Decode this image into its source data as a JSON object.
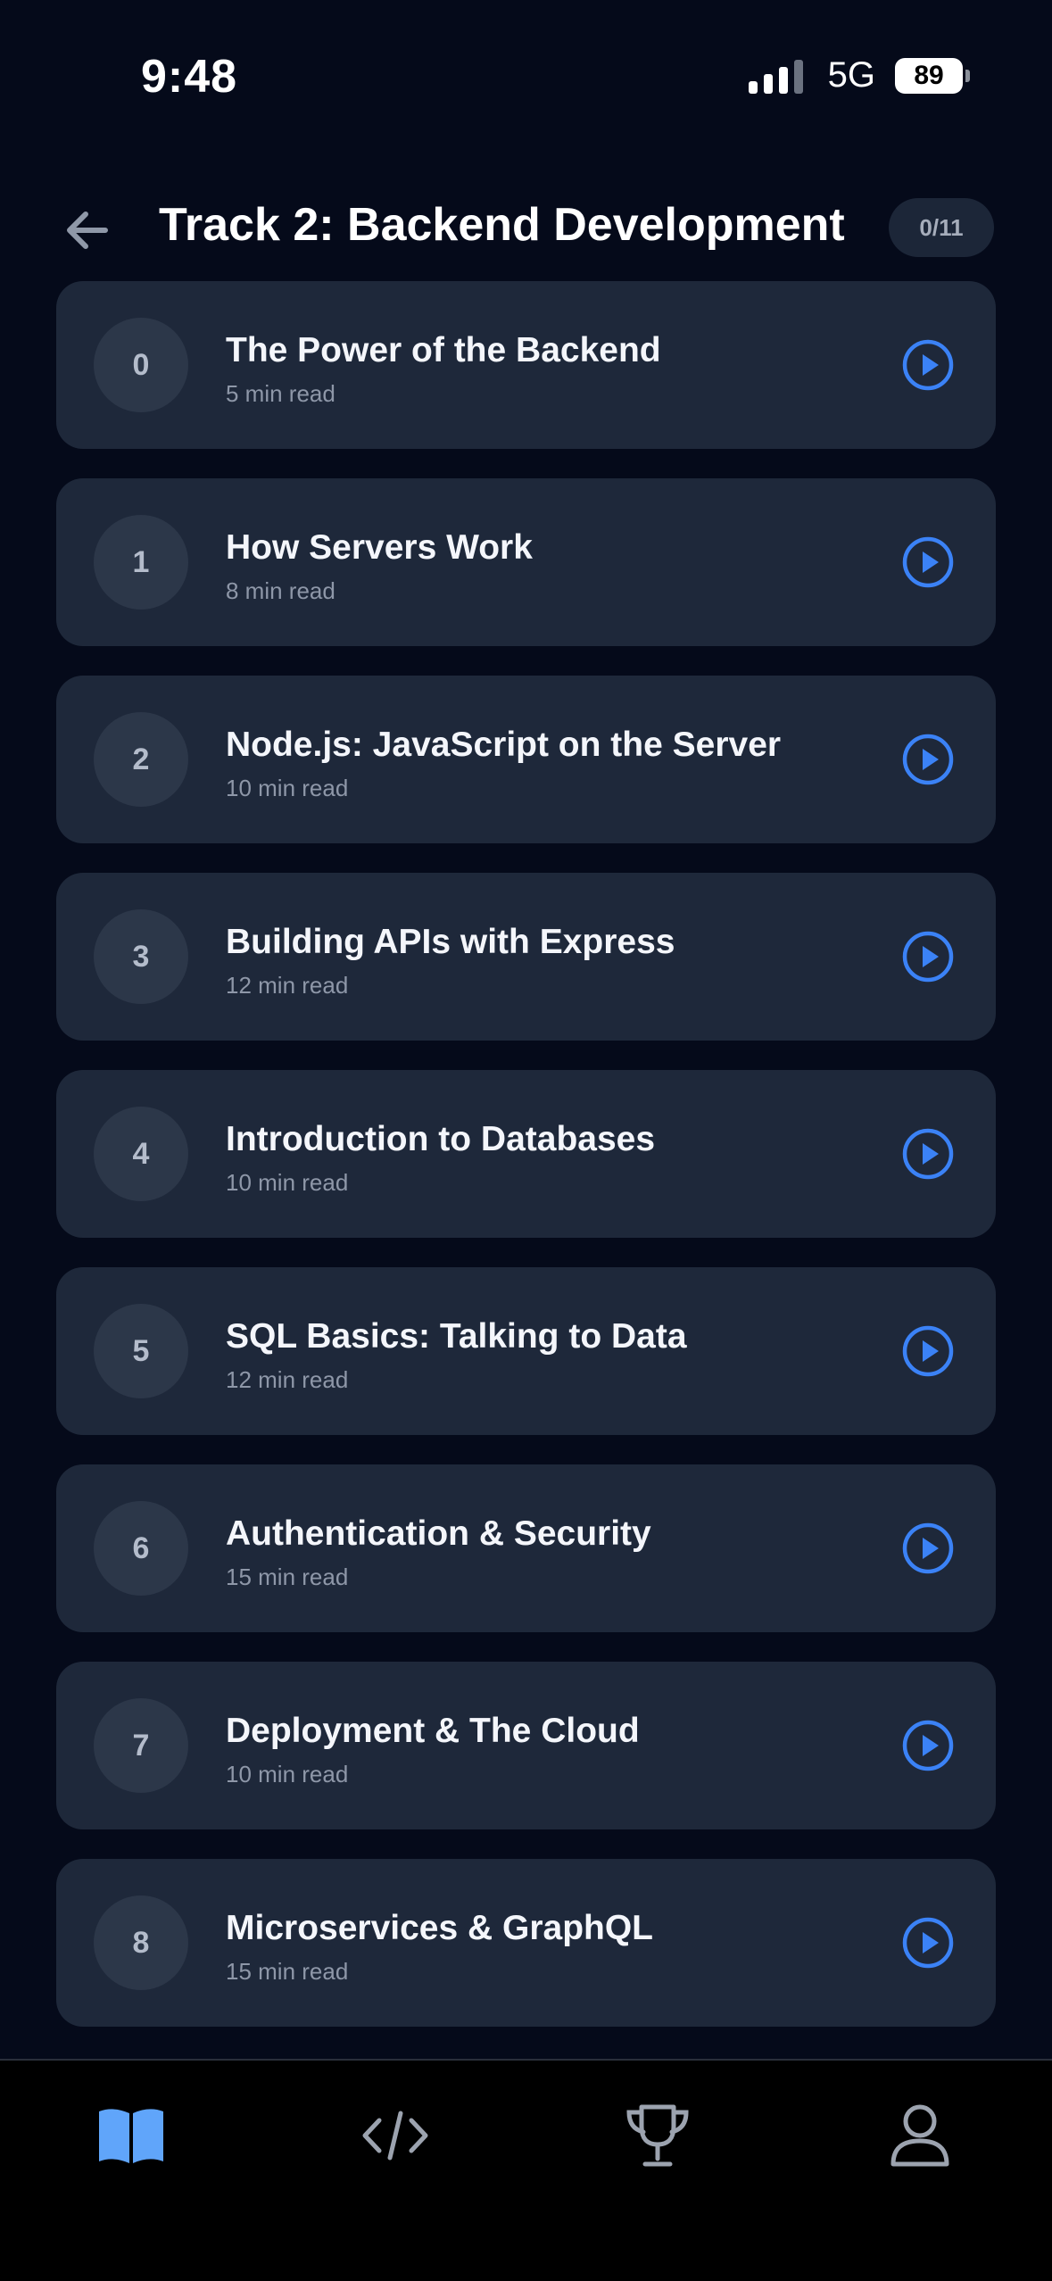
{
  "status_bar": {
    "time": "9:48",
    "network": "5G",
    "battery": "89"
  },
  "header": {
    "title": "Track 2: Backend Development",
    "progress": "0/11",
    "back_icon": "arrow-left-icon"
  },
  "lessons": [
    {
      "number": "0",
      "title": "The Power of the Backend",
      "meta": "5 min read"
    },
    {
      "number": "1",
      "title": "How Servers Work",
      "meta": "8 min read"
    },
    {
      "number": "2",
      "title": "Node.js: JavaScript on the Server",
      "meta": "10 min read"
    },
    {
      "number": "3",
      "title": "Building APIs with Express",
      "meta": "12 min read"
    },
    {
      "number": "4",
      "title": "Introduction to Databases",
      "meta": "10 min read"
    },
    {
      "number": "5",
      "title": "SQL Basics: Talking to Data",
      "meta": "12 min read"
    },
    {
      "number": "6",
      "title": "Authentication & Security",
      "meta": "15 min read"
    },
    {
      "number": "7",
      "title": "Deployment & The Cloud",
      "meta": "10 min read"
    },
    {
      "number": "8",
      "title": "Microservices & GraphQL",
      "meta": "15 min read"
    }
  ],
  "tab_bar": {
    "items": [
      {
        "icon": "book-icon",
        "active": true
      },
      {
        "icon": "code-icon",
        "active": false
      },
      {
        "icon": "trophy-icon",
        "active": false
      },
      {
        "icon": "user-icon",
        "active": false
      }
    ]
  },
  "colors": {
    "background": "#050a1a",
    "card": "#1e283a",
    "accent": "#3b82f6",
    "inactive_icon": "#9ca3af"
  }
}
